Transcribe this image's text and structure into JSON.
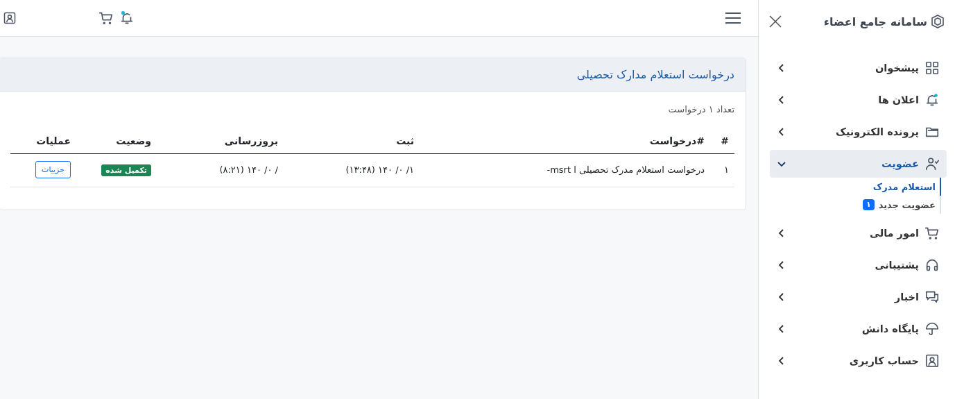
{
  "topbar": {
    "unread": true
  },
  "card": {
    "title": "درخواست استعلام مدارک تحصیلی",
    "count": "تعداد ۱ درخواست",
    "table": {
      "columns": [
        "#",
        "#درخواست",
        "ثبت",
        "بروزرسانی",
        "وضعیت",
        "عملیات"
      ],
      "rows": [
        {
          "index": "۱",
          "request": "درخواست استعلام مدرک تحصیلی ا msrt-",
          "created": "(۱۳:۴۸) ۱۴۰  /۰  /۱",
          "updated": "(۸:۲۱) ۱۴۰  /۰  /",
          "status": "تکمیل شده",
          "action": "جزییات"
        }
      ]
    }
  },
  "sidebar": {
    "title": "سامانه جامع اعضاء",
    "items": [
      {
        "label": "پیشخوان",
        "expanded": false
      },
      {
        "label": "اعلان ها",
        "expanded": false
      },
      {
        "label": "پرونده الکترونیک",
        "expanded": false
      },
      {
        "label": "عضویت",
        "expanded": true,
        "children": [
          {
            "label": "استعلام مدرک",
            "selected": true
          },
          {
            "label": "عضویت جدید",
            "selected": false,
            "badge": "۱"
          }
        ]
      },
      {
        "label": "امور مالی",
        "expanded": false
      },
      {
        "label": "پشتیبانی",
        "expanded": false
      },
      {
        "label": "اخبار",
        "expanded": false
      },
      {
        "label": "پایگاه دانش",
        "expanded": false
      },
      {
        "label": "حساب کاربری",
        "expanded": false
      }
    ]
  }
}
